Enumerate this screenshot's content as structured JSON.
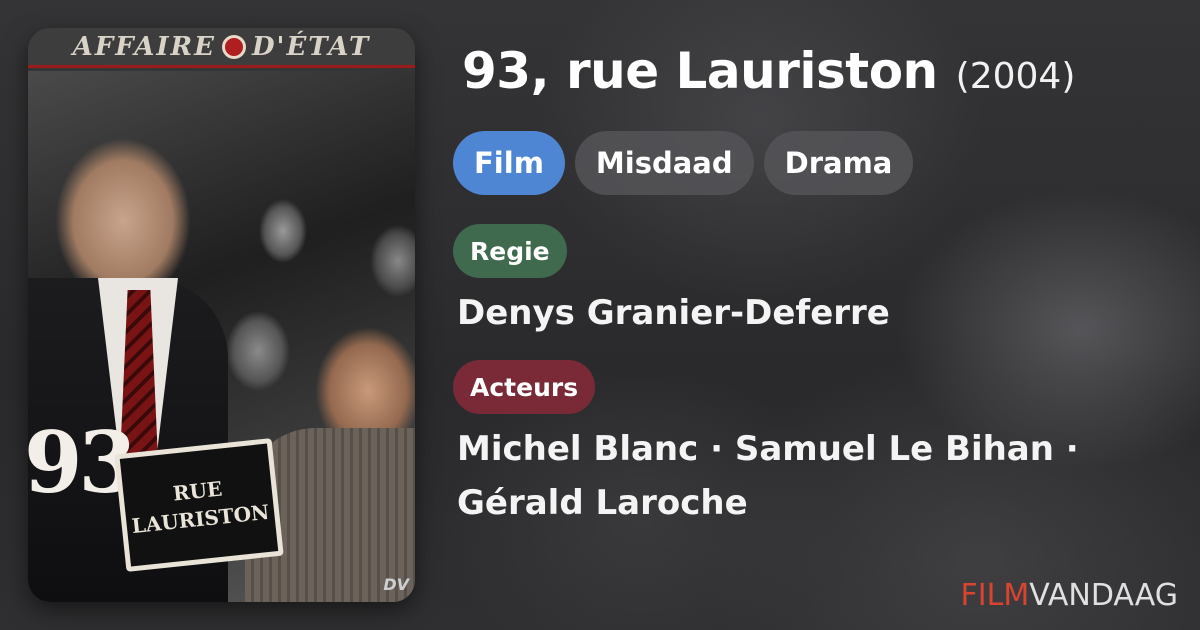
{
  "poster": {
    "banner_left": "AFFAIRE",
    "banner_right": "D'ÉTAT",
    "number": "93",
    "sign_line1": "RUE",
    "sign_line2": "LAURISTON",
    "corner": "DV"
  },
  "movie": {
    "title": "93, rue Lauriston",
    "year": "(2004)"
  },
  "genres": [
    "Film",
    "Misdaad",
    "Drama"
  ],
  "director_label": "Regie",
  "director": "Denys Granier-Deferre",
  "actors_label": "Acteurs",
  "actors": "Michel Blanc · Samuel Le Bihan · Gérald Laroche",
  "brand": {
    "part1": "FILM",
    "part2": "VANDAAG"
  },
  "colors": {
    "primary_chip": "#4f86d4",
    "regie_chip": "#3f6a4e",
    "acteurs_chip": "#7a2a36",
    "brand_accent": "#d9442f"
  }
}
